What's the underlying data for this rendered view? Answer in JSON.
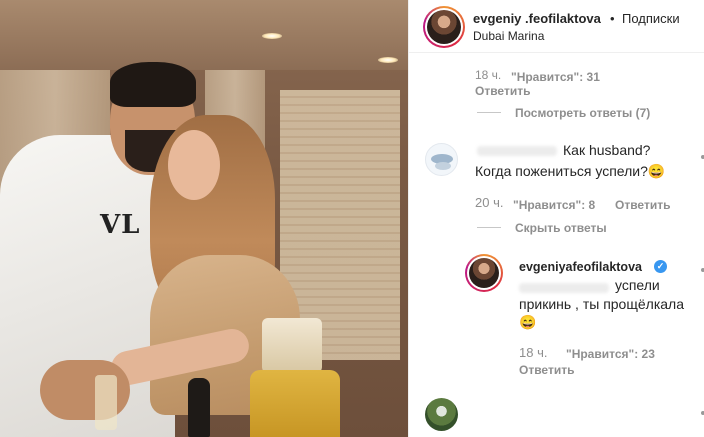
{
  "header": {
    "username": "evgeniya_feofilaktova",
    "username_display": "evgeniy .feofilaktova",
    "separator": "•",
    "follow_label": "Подписки",
    "location": "Dubai Marina"
  },
  "photo": {
    "shirt_print": "VL"
  },
  "comments": [
    {
      "time": "18 ч.",
      "likes_label": "\"Нравится\": 31",
      "reply_label": "Ответить",
      "toggle_label": "Посмотреть ответы (7)"
    },
    {
      "text_line1": "Как husband?",
      "text_line2": "Когда пожениться успели?😄",
      "time": "20 ч.",
      "likes_label": "\"Нравится\": 8",
      "reply_label": "Ответить",
      "toggle_label": "Скрыть ответы"
    }
  ],
  "reply": {
    "username": "evgeniyafeofilaktova",
    "text_line1_visible": "успели",
    "text_line2": "прикинь , ты прощёлкала",
    "text_line3": "😄",
    "time": "18 ч.",
    "likes_label": "\"Нравится\": 23",
    "reply_label": "Ответить"
  },
  "icons": {
    "verified": "verified-badge-icon",
    "more": "more-icon"
  },
  "colors": {
    "text": "#262626",
    "meta": "#8e8e8e",
    "verified": "#3897f0",
    "divider": "#efefef"
  }
}
